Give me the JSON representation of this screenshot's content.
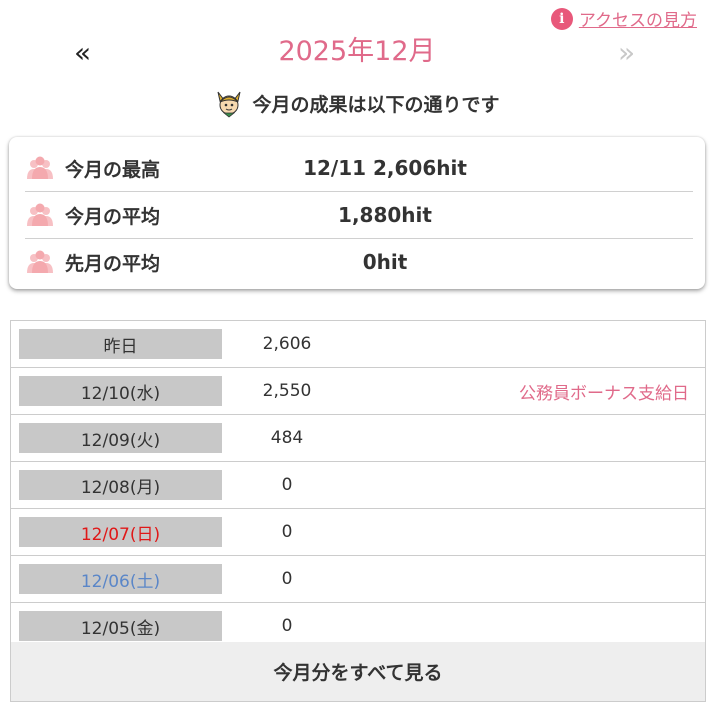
{
  "help": {
    "label": "アクセスの見方",
    "icon": "info-icon"
  },
  "month_nav": {
    "prev_label": "«",
    "next_label": "»",
    "title": "2025年12月"
  },
  "subtitle": {
    "text": "今月の成果は以下の通りです",
    "icon": "mascot-icon"
  },
  "summary": {
    "icon": "people-icon",
    "rows": [
      {
        "label": "今月の最高",
        "value": "12/11 2,606hit"
      },
      {
        "label": "今月の平均",
        "value": "1,880hit"
      },
      {
        "label": "先月の平均",
        "value": "0hit"
      }
    ]
  },
  "daily": {
    "rows": [
      {
        "date": "昨日",
        "value": "2,606",
        "note": "",
        "day_type": "weekday"
      },
      {
        "date": "12/10(水)",
        "value": "2,550",
        "note": "公務員ボーナス支給日",
        "day_type": "weekday"
      },
      {
        "date": "12/09(火)",
        "value": "484",
        "note": "",
        "day_type": "weekday"
      },
      {
        "date": "12/08(月)",
        "value": "0",
        "note": "",
        "day_type": "weekday"
      },
      {
        "date": "12/07(日)",
        "value": "0",
        "note": "",
        "day_type": "sunday"
      },
      {
        "date": "12/06(土)",
        "value": "0",
        "note": "",
        "day_type": "saturday"
      },
      {
        "date": "12/05(金)",
        "value": "0",
        "note": "",
        "day_type": "weekday"
      }
    ],
    "see_all_label": "今月分をすべて見る"
  },
  "colors": {
    "accent_pink": "#e06a8a",
    "sunday_red": "#e01818",
    "saturday_blue": "#5a86c8",
    "label_gray": "#c8c8c8"
  }
}
